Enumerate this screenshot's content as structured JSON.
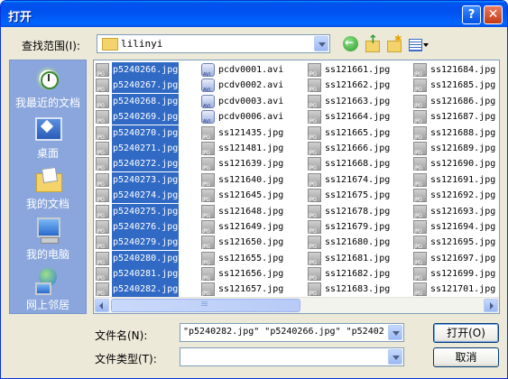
{
  "window": {
    "title": "打开",
    "help": "?",
    "close": "✕"
  },
  "lookin": {
    "label": "查找范围(I):",
    "value": "lilinyi"
  },
  "places": [
    {
      "label": "我最近的文档"
    },
    {
      "label": "桌面"
    },
    {
      "label": "我的文档"
    },
    {
      "label": "我的电脑"
    },
    {
      "label": "网上邻居"
    }
  ],
  "files": {
    "col1": [
      "p5240266.jpg",
      "p5240267.jpg",
      "p5240268.jpg",
      "p5240269.jpg",
      "p5240270.jpg",
      "p5240271.jpg",
      "p5240272.jpg",
      "p5240273.jpg",
      "p5240274.jpg",
      "p5240275.jpg",
      "p5240276.jpg",
      "p5240279.jpg",
      "p5240280.jpg",
      "p5240281.jpg",
      "p5240282.jpg"
    ],
    "col2": [
      "pcdv0001.avi",
      "pcdv0002.avi",
      "pcdv0003.avi",
      "pcdv0006.avi",
      "ss121435.jpg",
      "ss121481.jpg",
      "ss121639.jpg",
      "ss121640.jpg",
      "ss121645.jpg",
      "ss121648.jpg",
      "ss121649.jpg",
      "ss121650.jpg",
      "ss121655.jpg",
      "ss121656.jpg",
      "ss121657.jpg"
    ],
    "col3": [
      "ss121661.jpg",
      "ss121662.jpg",
      "ss121663.jpg",
      "ss121664.jpg",
      "ss121665.jpg",
      "ss121666.jpg",
      "ss121668.jpg",
      "ss121674.jpg",
      "ss121675.jpg",
      "ss121678.jpg",
      "ss121679.jpg",
      "ss121680.jpg",
      "ss121681.jpg",
      "ss121682.jpg",
      "ss121683.jpg"
    ],
    "col4": [
      "ss121684.jpg",
      "ss121685.jpg",
      "ss121686.jpg",
      "ss121687.jpg",
      "ss121688.jpg",
      "ss121689.jpg",
      "ss121690.jpg",
      "ss121691.jpg",
      "ss121692.jpg",
      "ss121693.jpg",
      "ss121694.jpg",
      "ss121695.jpg",
      "ss121697.jpg",
      "ss121699.jpg",
      "ss121701.jpg"
    ]
  },
  "filename": {
    "label": "文件名(N):",
    "value": "\"p5240282.jpg\" \"p5240266.jpg\" \"p52402"
  },
  "filetype": {
    "label": "文件类型(T):",
    "value": ""
  },
  "buttons": {
    "open": "打开(O)",
    "cancel": "取消"
  },
  "colors": {
    "selection": "#316ac5",
    "places_bg": "#8aa6dc",
    "titlebar": "#0054e3"
  }
}
